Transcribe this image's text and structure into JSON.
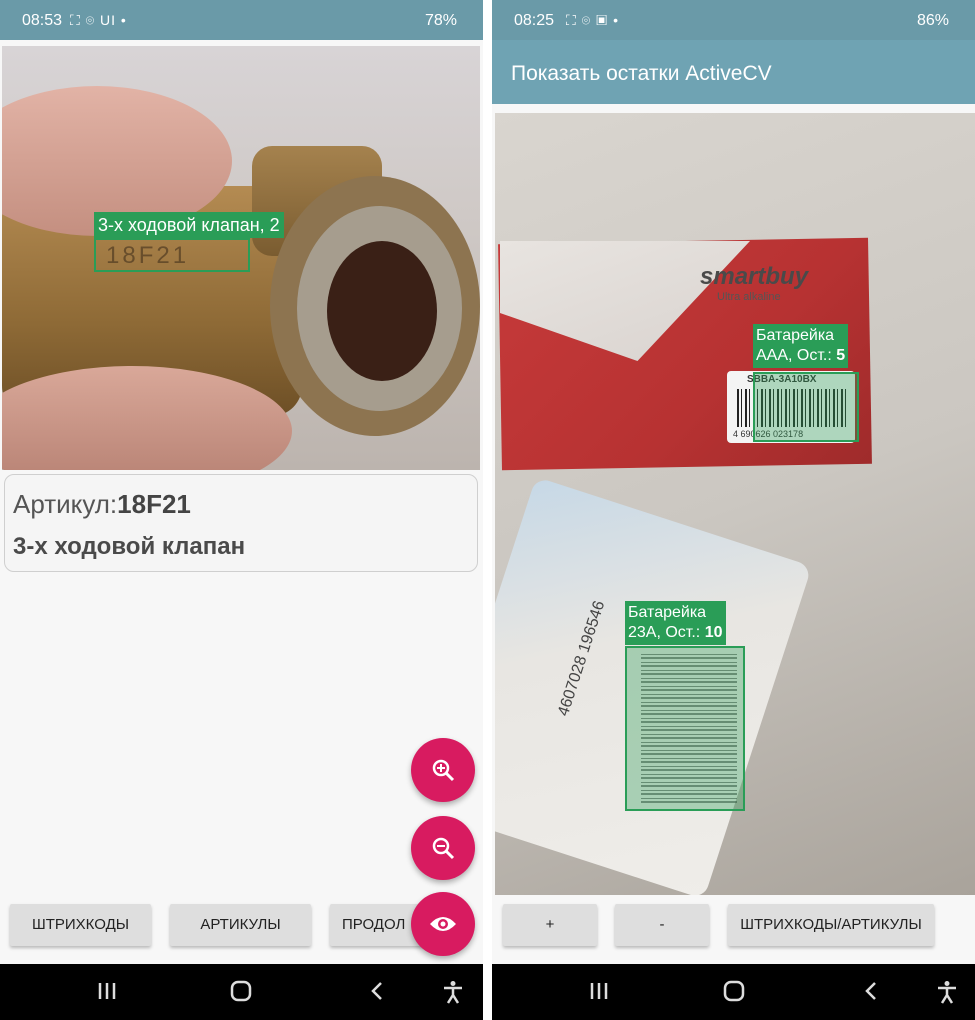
{
  "left": {
    "status": {
      "time": "08:53",
      "icons": "⛶ ⌾ UI •",
      "right": "78%"
    },
    "detection": {
      "label": "3-х ходовой клапан, 2"
    },
    "photo_marking": "18F21",
    "info": {
      "article_prefix": "Артикул:",
      "article_value": "18F21",
      "name": "3-х ходовой клапан"
    },
    "buttons": [
      "ШТРИХКОДЫ",
      "АРТИКУЛЫ",
      "ПРОДОЛ"
    ],
    "fabs": [
      "zoom-in-icon",
      "zoom-out-icon",
      "eye-icon"
    ]
  },
  "right": {
    "status": {
      "time": "08:25",
      "icons": "⛶ ⌾ ▣ •",
      "right": "86%"
    },
    "app_title": "Показать остатки ActiveCV",
    "box_brand": "smartbuy",
    "box_sub": "Ultra alkaline",
    "detections": [
      {
        "line1": "Батарейка",
        "line2_prefix": "AAA, Ост.: ",
        "qty": "5",
        "barcode_top": "SBBA-3A10BX",
        "barcode_digits": "4 690626 023178"
      },
      {
        "line1": "Батарейка",
        "line2_prefix": "23A, Ост.: ",
        "qty": "10",
        "barcode_digits": "4607028 196546"
      }
    ],
    "buttons": [
      "+",
      "-",
      "ШТРИХКОДЫ/АРТИКУЛЫ"
    ]
  },
  "colors": {
    "status_bar": "#6a9aa8",
    "app_bar": "#6fa3b3",
    "accent": "#d81b60",
    "detect_green": "#2a9d57"
  }
}
